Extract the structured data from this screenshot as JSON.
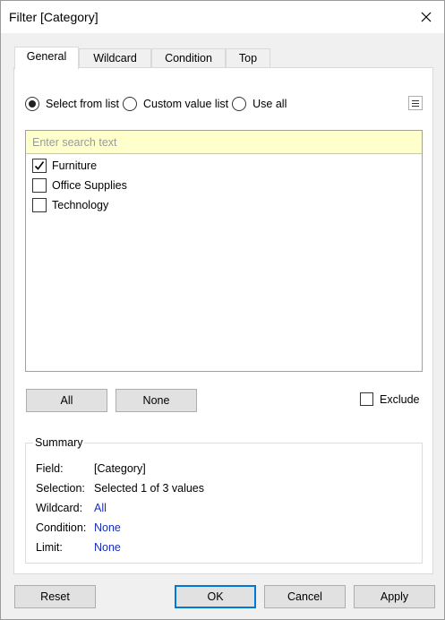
{
  "window": {
    "title": "Filter [Category]"
  },
  "tabs": [
    {
      "label": "General",
      "active": true
    },
    {
      "label": "Wildcard",
      "active": false
    },
    {
      "label": "Condition",
      "active": false
    },
    {
      "label": "Top",
      "active": false
    }
  ],
  "general": {
    "radios": [
      {
        "label": "Select from list",
        "selected": true
      },
      {
        "label": "Custom value list",
        "selected": false
      },
      {
        "label": "Use all",
        "selected": false
      }
    ],
    "search": {
      "placeholder": "Enter search text",
      "value": ""
    },
    "items": [
      {
        "label": "Furniture",
        "checked": true
      },
      {
        "label": "Office Supplies",
        "checked": false
      },
      {
        "label": "Technology",
        "checked": false
      }
    ],
    "all_label": "All",
    "none_label": "None",
    "exclude_label": "Exclude",
    "exclude_checked": false
  },
  "summary": {
    "legend": "Summary",
    "rows": [
      {
        "key": "Field:",
        "value": "[Category]",
        "link": false
      },
      {
        "key": "Selection:",
        "value": "Selected 1 of 3 values",
        "link": false
      },
      {
        "key": "Wildcard:",
        "value": "All",
        "link": true
      },
      {
        "key": "Condition:",
        "value": "None",
        "link": true
      },
      {
        "key": "Limit:",
        "value": "None",
        "link": true
      }
    ]
  },
  "footer": {
    "reset_label": "Reset",
    "ok_label": "OK",
    "cancel_label": "Cancel",
    "apply_label": "Apply"
  },
  "colors": {
    "accent": "#0078d7",
    "link": "#1a2fb8",
    "search_bg": "#ffffcc"
  }
}
